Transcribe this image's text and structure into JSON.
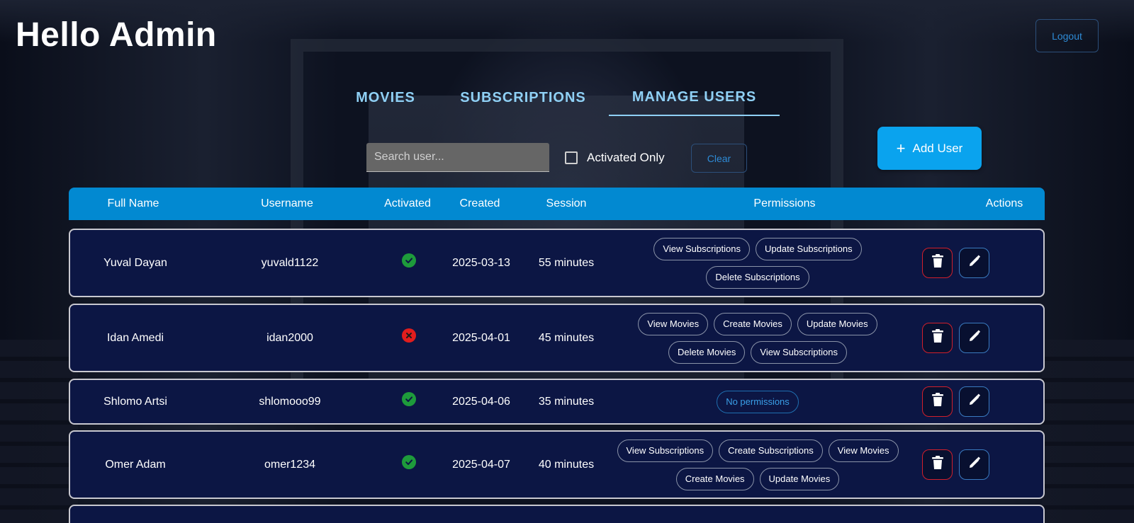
{
  "header": {
    "greeting": "Hello Admin",
    "logout_label": "Logout"
  },
  "tabs": [
    {
      "label": "MOVIES",
      "active": false
    },
    {
      "label": "SUBSCRIPTIONS",
      "active": false
    },
    {
      "label": "MANAGE USERS",
      "active": true
    }
  ],
  "toolbar": {
    "search_placeholder": "Search user...",
    "search_value": "",
    "activated_only_label": "Activated Only",
    "activated_only_checked": false,
    "clear_label": "Clear",
    "add_user_label": "Add User"
  },
  "table": {
    "columns": [
      "Full Name",
      "Username",
      "Activated",
      "Created",
      "Session",
      "Permissions",
      "Actions"
    ],
    "rows": [
      {
        "full_name": "Yuval Dayan",
        "username": "yuvald1122",
        "activated": true,
        "created": "2025-03-13",
        "session": "55 minutes",
        "permissions": [
          "View Subscriptions",
          "Update Subscriptions",
          "Delete Subscriptions"
        ]
      },
      {
        "full_name": "Idan Amedi",
        "username": "idan2000",
        "activated": false,
        "created": "2025-04-01",
        "session": "45 minutes",
        "permissions": [
          "View Movies",
          "Create Movies",
          "Update Movies",
          "Delete Movies",
          "View Subscriptions"
        ]
      },
      {
        "full_name": "Shlomo Artsi",
        "username": "shlomooo99",
        "activated": true,
        "created": "2025-04-06",
        "session": "35 minutes",
        "permissions": []
      },
      {
        "full_name": "Omer Adam",
        "username": "omer1234",
        "activated": true,
        "created": "2025-04-07",
        "session": "40 minutes",
        "permissions": [
          "View Subscriptions",
          "Create Subscriptions",
          "View Movies",
          "Create Movies",
          "Update Movies"
        ]
      }
    ],
    "no_permissions_label": "No permissions"
  },
  "colors": {
    "accent": "#0289d1",
    "add_button": "#0aa3ee",
    "tab_text": "#8fd0f5",
    "row_bg": "#0c1644",
    "activated": "#1e9b3b",
    "deactivated": "#e11d1d",
    "delete_border": "#d21f2b"
  },
  "icons": {
    "activated": "check-circle-icon",
    "deactivated": "x-circle-icon",
    "delete": "trash-icon",
    "edit": "pencil-icon",
    "add": "plus-icon"
  }
}
